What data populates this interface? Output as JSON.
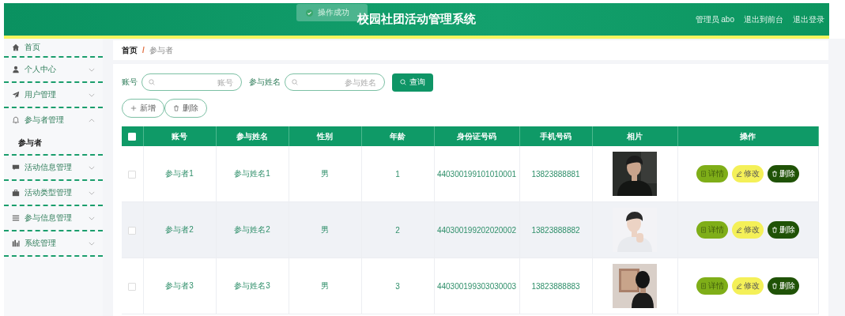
{
  "header": {
    "title": "校园社团活动管理系统",
    "user": "管理员 abo",
    "links": [
      "退出到前台",
      "退出登录"
    ]
  },
  "toast": {
    "kind": "success",
    "text": "操作成功"
  },
  "sidebar": {
    "items": [
      {
        "label": "首页"
      },
      {
        "label": "个人中心",
        "expanded": false
      },
      {
        "label": "用户管理",
        "expanded": false
      },
      {
        "label": "参与者管理",
        "expanded": true,
        "children": [
          {
            "label": "参与者",
            "selected": true
          }
        ]
      },
      {
        "label": "活动信息管理",
        "expanded": false
      },
      {
        "label": "活动类型管理",
        "expanded": false
      },
      {
        "label": "参与信息管理",
        "expanded": false
      },
      {
        "label": "系统管理",
        "expanded": false
      }
    ]
  },
  "breadcrumb": {
    "items": [
      "首页",
      "参与者"
    ],
    "separator": "/"
  },
  "search": {
    "fields": [
      {
        "label": "账号",
        "placeholder": "账号"
      },
      {
        "label": "参与姓名",
        "placeholder": "参与姓名"
      }
    ],
    "button": "查询"
  },
  "toolbar": [
    {
      "kind": "add",
      "label": "新增"
    },
    {
      "kind": "delete",
      "label": "删除"
    }
  ],
  "table": {
    "select_all": {
      "checked": false
    },
    "columns": [
      "账号",
      "参与姓名",
      "性别",
      "年龄",
      "身份证号码",
      "手机号码",
      "相片",
      "操作"
    ],
    "rows": [
      {
        "checked": false,
        "hovered": false,
        "cells": [
          "参与者1",
          "参与姓名1",
          "男",
          "1",
          "440300199101010001",
          "13823888881"
        ],
        "actions": [
          {
            "kind": "detail",
            "label": "详情"
          },
          {
            "kind": "edit",
            "label": "修改"
          },
          {
            "kind": "delete",
            "label": "删除"
          }
        ]
      },
      {
        "checked": false,
        "hovered": true,
        "cells": [
          "参与者2",
          "参与姓名2",
          "男",
          "2",
          "440300199202020002",
          "13823888882"
        ],
        "actions": [
          {
            "kind": "detail",
            "label": "详情"
          },
          {
            "kind": "edit",
            "label": "修改"
          },
          {
            "kind": "delete",
            "label": "删除"
          }
        ]
      },
      {
        "checked": false,
        "hovered": false,
        "cells": [
          "参与者3",
          "参与姓名3",
          "男",
          "3",
          "440300199303030003",
          "13823888883"
        ],
        "actions": [
          {
            "kind": "detail",
            "label": "详情"
          },
          {
            "kind": "edit",
            "label": "修改"
          },
          {
            "kind": "delete",
            "label": "删除"
          }
        ]
      }
    ]
  }
}
